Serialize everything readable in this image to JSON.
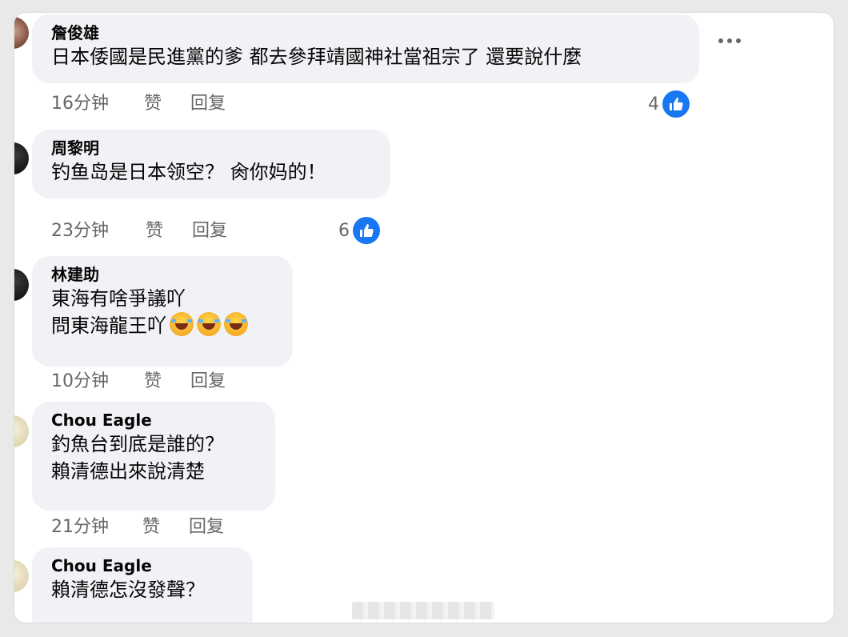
{
  "accent_color": "#1877f2",
  "menu_icon": "more-horizontal-icon",
  "like_label": "赞",
  "reply_label": "回复",
  "comments": [
    {
      "author": "詹俊雄",
      "lines": [
        "日本倭國是民進黨的爹 都去參拜靖國神社當祖宗了 還要說什麼"
      ],
      "time": "16分钟",
      "likes": "4"
    },
    {
      "author": "周黎明",
      "lines": [
        "钓鱼岛是日本领空？ 肏你妈的！"
      ],
      "time": "23分钟",
      "likes": "6"
    },
    {
      "author": "林建助",
      "lines": [
        "東海有啥爭議吖",
        "問東海龍王吖"
      ],
      "emoji": "rolling-on-floor-laughing-icon",
      "time": "10分钟"
    },
    {
      "author": "Chou Eagle",
      "lines": [
        "釣魚台到底是誰的？",
        "賴清德出來說清楚"
      ],
      "time": "21分钟"
    },
    {
      "author": "Chou Eagle",
      "lines": [
        "賴清德怎沒發聲？"
      ]
    }
  ]
}
